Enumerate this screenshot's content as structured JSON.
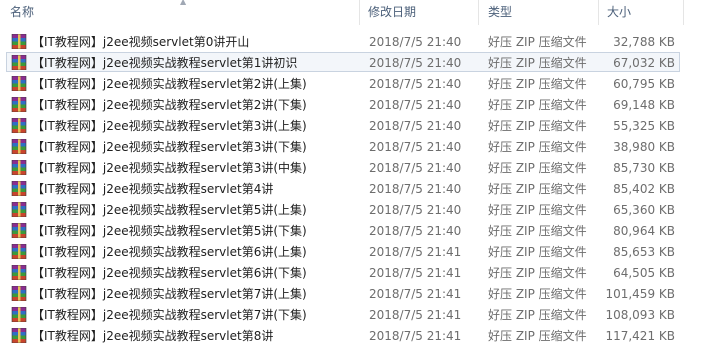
{
  "header": {
    "name_label": "名称",
    "date_label": "修改日期",
    "type_label": "类型",
    "size_label": "大小"
  },
  "icon": "winrar-zip-archive-icon",
  "colors": {
    "header_text": "#4c607a",
    "selection_border": "#c9d3e0",
    "selection_fill": "#f3f6fa"
  },
  "files": [
    {
      "name": "【IT教程网】j2ee视频servlet第0讲开山",
      "date": "2018/7/5 21:40",
      "type": "好压 ZIP 压缩文件",
      "size": "32,788 KB",
      "selected": false
    },
    {
      "name": "【IT教程网】j2ee视频实战教程servlet第1讲初识",
      "date": "2018/7/5 21:40",
      "type": "好压 ZIP 压缩文件",
      "size": "67,032 KB",
      "selected": true
    },
    {
      "name": "【IT教程网】j2ee视频实战教程servlet第2讲(上集)",
      "date": "2018/7/5 21:40",
      "type": "好压 ZIP 压缩文件",
      "size": "60,795 KB",
      "selected": false
    },
    {
      "name": "【IT教程网】j2ee视频实战教程servlet第2讲(下集)",
      "date": "2018/7/5 21:40",
      "type": "好压 ZIP 压缩文件",
      "size": "69,148 KB",
      "selected": false
    },
    {
      "name": "【IT教程网】j2ee视频实战教程servlet第3讲(上集)",
      "date": "2018/7/5 21:40",
      "type": "好压 ZIP 压缩文件",
      "size": "55,325 KB",
      "selected": false
    },
    {
      "name": "【IT教程网】j2ee视频实战教程servlet第3讲(下集)",
      "date": "2018/7/5 21:40",
      "type": "好压 ZIP 压缩文件",
      "size": "38,980 KB",
      "selected": false
    },
    {
      "name": "【IT教程网】j2ee视频实战教程servlet第3讲(中集)",
      "date": "2018/7/5 21:40",
      "type": "好压 ZIP 压缩文件",
      "size": "85,730 KB",
      "selected": false
    },
    {
      "name": "【IT教程网】j2ee视频实战教程servlet第4讲",
      "date": "2018/7/5 21:40",
      "type": "好压 ZIP 压缩文件",
      "size": "85,402 KB",
      "selected": false
    },
    {
      "name": "【IT教程网】j2ee视频实战教程servlet第5讲(上集)",
      "date": "2018/7/5 21:40",
      "type": "好压 ZIP 压缩文件",
      "size": "65,360 KB",
      "selected": false
    },
    {
      "name": "【IT教程网】j2ee视频实战教程servlet第5讲(下集)",
      "date": "2018/7/5 21:40",
      "type": "好压 ZIP 压缩文件",
      "size": "80,964 KB",
      "selected": false
    },
    {
      "name": "【IT教程网】j2ee视频实战教程servlet第6讲(上集)",
      "date": "2018/7/5 21:41",
      "type": "好压 ZIP 压缩文件",
      "size": "85,653 KB",
      "selected": false
    },
    {
      "name": "【IT教程网】j2ee视频实战教程servlet第6讲(下集)",
      "date": "2018/7/5 21:41",
      "type": "好压 ZIP 压缩文件",
      "size": "64,505 KB",
      "selected": false
    },
    {
      "name": "【IT教程网】j2ee视频实战教程servlet第7讲(上集)",
      "date": "2018/7/5 21:41",
      "type": "好压 ZIP 压缩文件",
      "size": "101,459 KB",
      "selected": false
    },
    {
      "name": "【IT教程网】j2ee视频实战教程servlet第7讲(下集)",
      "date": "2018/7/5 21:41",
      "type": "好压 ZIP 压缩文件",
      "size": "108,093 KB",
      "selected": false
    },
    {
      "name": "【IT教程网】j2ee视频实战教程servlet第8讲",
      "date": "2018/7/5 21:41",
      "type": "好压 ZIP 压缩文件",
      "size": "117,421 KB",
      "selected": false
    }
  ]
}
